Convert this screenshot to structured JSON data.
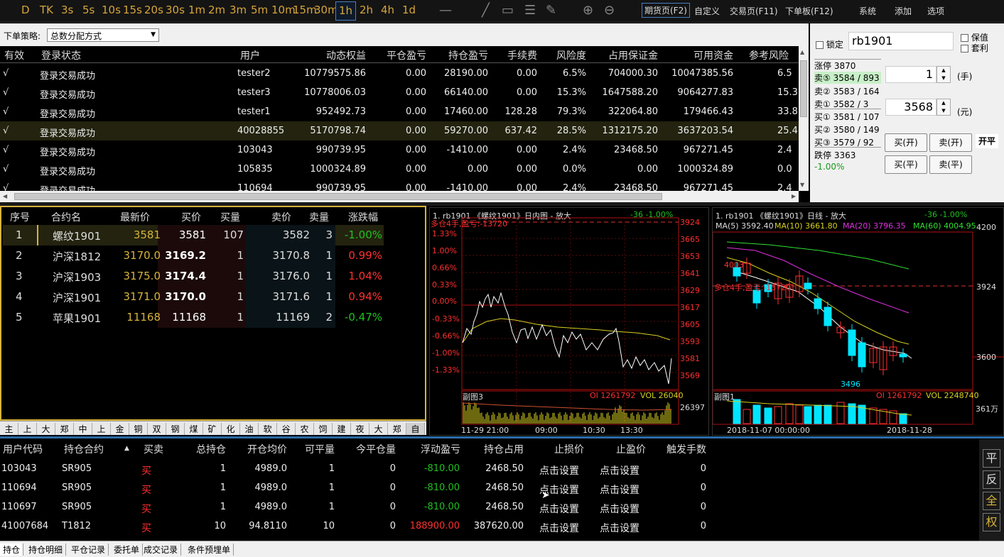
{
  "toolbar": {
    "periods": [
      "D",
      "TK",
      "3s",
      "5s",
      "10s",
      "15s",
      "20s",
      "30s",
      "1m",
      "2m",
      "3m",
      "5m",
      "10m",
      "15m",
      "30m",
      "1h",
      "2h",
      "4h",
      "1d"
    ],
    "active_period": "1h",
    "menus": [
      "期货页(F2)",
      "自定义",
      "交易页(F11)",
      "下单板(F12)",
      "系统",
      "添加",
      "选项"
    ],
    "active_menu": "期货页(F2)"
  },
  "strategy": {
    "label": "下单策略:",
    "value": "总数分配方式"
  },
  "accounts": {
    "headers": [
      "有效",
      "登录状态",
      "用户",
      "动态权益",
      "平仓盈亏",
      "持仓盈亏",
      "手续费",
      "风险度",
      "占用保证金",
      "可用资金",
      "参考风险"
    ],
    "rows": [
      [
        "√",
        "登录交易成功",
        "tester2",
        "10779575.86",
        "0.00",
        "28190.00",
        "0.00",
        "6.5%",
        "704000.30",
        "10047385.56",
        "6.5"
      ],
      [
        "√",
        "登录交易成功",
        "tester3",
        "10778006.03",
        "0.00",
        "66140.00",
        "0.00",
        "15.3%",
        "1647588.20",
        "9064277.83",
        "15.3"
      ],
      [
        "√",
        "登录交易成功",
        "tester1",
        "952492.73",
        "0.00",
        "17460.00",
        "128.28",
        "79.3%",
        "322064.80",
        "179466.43",
        "33.8"
      ],
      [
        "√",
        "登录交易成功",
        "40028855",
        "5170798.74",
        "0.00",
        "59270.00",
        "637.42",
        "28.5%",
        "1312175.20",
        "3637203.54",
        "25.4"
      ],
      [
        "√",
        "登录交易成功",
        "103043",
        "990739.95",
        "0.00",
        "-1410.00",
        "0.00",
        "2.4%",
        "23468.50",
        "967271.45",
        "2.4"
      ],
      [
        "√",
        "登录交易成功",
        "105835",
        "1000324.89",
        "0.00",
        "0.00",
        "0.00",
        "0.0%",
        "0.00",
        "1000324.89",
        "0.0"
      ],
      [
        "√",
        "登录交易成功",
        "110694",
        "990739.95",
        "0.00",
        "-1410.00",
        "0.00",
        "2.4%",
        "23468.50",
        "967271.45",
        "2.4"
      ]
    ]
  },
  "order": {
    "lock_label": "锁定",
    "contract": "rb1901",
    "hedge_label": "保值",
    "arb_label": "套利",
    "limit_up": "涨停 3870",
    "asks": [
      "卖⑤ 3584 / 893",
      "卖② 3583 / 164",
      "卖① 3582 / 3"
    ],
    "bids": [
      "买① 3581 / 107",
      "买② 3580 / 149",
      "买③ 3579 / 92"
    ],
    "limit_down": "跌停 3363",
    "change": "-1.00%",
    "qty": "1",
    "qty_unit": "(手)",
    "price": "3568",
    "price_unit": "(元)",
    "buy_open": "买(开)",
    "sell_open": "卖(开)",
    "buy_close": "买(平)",
    "sell_close": "卖(平)",
    "open_close": "开平"
  },
  "quotes": {
    "headers": [
      "序号",
      "合约名",
      "最新价",
      "买价",
      "买量",
      "卖价",
      "卖量",
      "涨跌幅"
    ],
    "rows": [
      {
        "no": "1",
        "name": "螺纹1901",
        "last": "3581",
        "bid": "3581",
        "bidv": "107",
        "ask": "3582",
        "askv": "3",
        "chg": "-1.00%",
        "up": false
      },
      {
        "no": "2",
        "name": "沪深1812",
        "last": "3170.0",
        "bid": "3169.2",
        "bidv": "1",
        "ask": "3170.8",
        "askv": "1",
        "chg": "0.99%",
        "up": true
      },
      {
        "no": "3",
        "name": "沪深1903",
        "last": "3175.0",
        "bid": "3174.4",
        "bidv": "1",
        "ask": "3176.0",
        "askv": "1",
        "chg": "1.04%",
        "up": true
      },
      {
        "no": "4",
        "name": "沪深1901",
        "last": "3171.0",
        "bid": "3170.0",
        "bidv": "1",
        "ask": "3171.6",
        "askv": "1",
        "chg": "0.94%",
        "up": true
      },
      {
        "no": "5",
        "name": "苹果1901",
        "last": "11168",
        "bid": "11168",
        "bidv": "1",
        "ask": "11169",
        "askv": "2",
        "chg": "-0.47%",
        "up": false
      }
    ]
  },
  "exchanges": [
    "主",
    "上",
    "大",
    "郑",
    "中",
    "上",
    "金",
    "铜",
    "双",
    "钢",
    "煤",
    "矿",
    "化",
    "油",
    "软",
    "谷",
    "农",
    "饲",
    "建",
    "夜",
    "大",
    "郑",
    "自"
  ],
  "chart_intraday": {
    "title": "1. rb1901 《螺纹1901》日内图 - 放大",
    "stat": "-36   -1.00%",
    "pos": "多仓4手,盈亏:-13720",
    "left_ticks": [
      "1.33%",
      "1.00%",
      "0.66%",
      "0.33%",
      "0.00%",
      "-0.33%",
      "-0.66%",
      "-1.00%",
      "-1.33%"
    ],
    "right_ticks": [
      "3924",
      "3665",
      "3653",
      "3641",
      "3629",
      "3617",
      "3605",
      "3593",
      "3581",
      "3569"
    ],
    "sub": "副图3",
    "oi": "OI 1261792",
    "vol": "VOL 26040",
    "vol_tick": "26397",
    "x_ticks": [
      "11-29 21:00",
      "09:00",
      "10:30",
      "13:30"
    ]
  },
  "chart_daily": {
    "title": "1. rb1901 《螺纹1901》日线 - 放大",
    "stat": "-36   -1.00%",
    "ma5": "MA(5) 3592.40",
    "ma10": "MA(10) 3661.80",
    "ma20": "MA(20) 3796.35",
    "ma60": "MA(60) 4004.95",
    "hi": "4003",
    "lo": "3496",
    "pos": "多仓4手,盈亏:-13720",
    "right_ticks": [
      "4200",
      "3924",
      "3600"
    ],
    "sub": "副图1",
    "oi": "OI 1261792",
    "vol": "VOL 2248740",
    "vol_tick": "361万",
    "x_ticks": [
      "2018-11-07 00:00:00",
      "2018-11-28"
    ]
  },
  "positions": {
    "headers": [
      "用户代码",
      "持仓合约",
      "买卖",
      "总持仓",
      "开仓均价",
      "可平量",
      "今平仓量",
      "浮动盈亏",
      "持仓占用",
      "止损价",
      "止盈价",
      "触发手数"
    ],
    "rows": [
      [
        "103043",
        "SR905",
        "买",
        "1",
        "4989.0",
        "1",
        "0",
        "-810.00",
        "2468.50",
        "点击设置",
        "点击设置",
        "0"
      ],
      [
        "110694",
        "SR905",
        "买",
        "1",
        "4989.0",
        "1",
        "0",
        "-810.00",
        "2468.50",
        "点击设置",
        "点击设置",
        "0"
      ],
      [
        "110697",
        "SR905",
        "买",
        "1",
        "4989.0",
        "1",
        "0",
        "-810.00",
        "2468.50",
        "点击设置",
        "点击设置",
        "0"
      ],
      [
        "41007684",
        "T1812",
        "买",
        "10",
        "94.8110",
        "10",
        "0",
        "188900.00",
        "387620.00",
        "点击设置",
        "点击设置",
        "0"
      ]
    ]
  },
  "side_buttons": [
    "平",
    "反",
    "全",
    "权"
  ],
  "bottom_tabs": [
    "持仓",
    "持仓明细",
    "平仓记录",
    "委托单",
    "成交记录",
    "条件预埋单"
  ],
  "colors": {
    "up": "#ff3030",
    "down": "#20c020",
    "gold": "#d6b33a",
    "accent": "#2b6ca8",
    "cyan": "#00e5ff"
  }
}
